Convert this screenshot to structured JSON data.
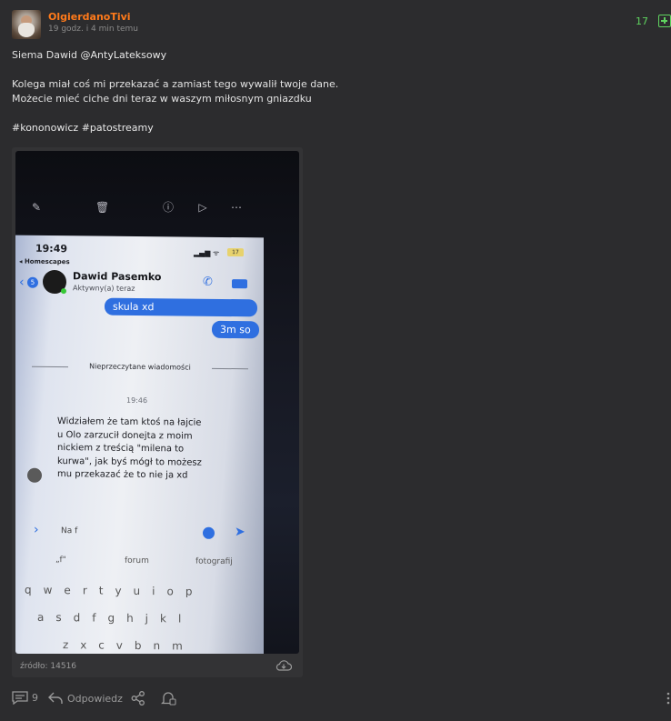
{
  "post": {
    "username": "OlgierdanoTivi",
    "timestamp": "19 godz. i 4 min temu",
    "votes": "17",
    "line1_prefix": "Siema Dawid ",
    "line1_mention": "@AntyLateksowy",
    "line2": "Kolega miał coś mi przekazać a zamiast tego wywalił twoje dane.",
    "line3": "Możecie mieć ciche dni teraz w waszym miłosnym gniazdku",
    "tags": [
      "#kononowicz",
      "#patostreamy"
    ]
  },
  "embed": {
    "source": "źródło: 14516",
    "photo": {
      "time": "19:49",
      "back_app": "◂ Homescapes",
      "battery": "17",
      "badge": "5",
      "contact_name": "Dawid Pasemko",
      "contact_status": "Aktywny(a) teraz",
      "bubble1": "skula xd",
      "bubble2": "3m so",
      "unread_separator": "Nieprzeczytane wiadomości",
      "time_mid": "19:46",
      "message": "Widziałem że tam ktoś na łajcie\nu Olo zarzucił donejta z moim\nnickiem z treścią \"milena to\nkurwa\", jak byś mógł to możesz\nmu przekazać że to nie ja xd",
      "input_text": "Na f",
      "suggestions": [
        "„f\"",
        "forum",
        "fotografij"
      ],
      "keyrow1": "qwertyuiop",
      "keyrow2": "asdfghjkl",
      "keyrow3": "zxcvbnm"
    }
  },
  "footer": {
    "comments_count": "9",
    "reply_label": "Odpowiedz"
  },
  "icons": {
    "comments": "comments-icon",
    "reply": "reply-icon",
    "share": "share-icon",
    "notify": "notify-bell-icon",
    "download": "cloud-download-icon",
    "plus": "plus-icon"
  },
  "colors": {
    "username": "#ff7a1a",
    "votes": "#5fd35f",
    "background": "#2c2c2e"
  }
}
